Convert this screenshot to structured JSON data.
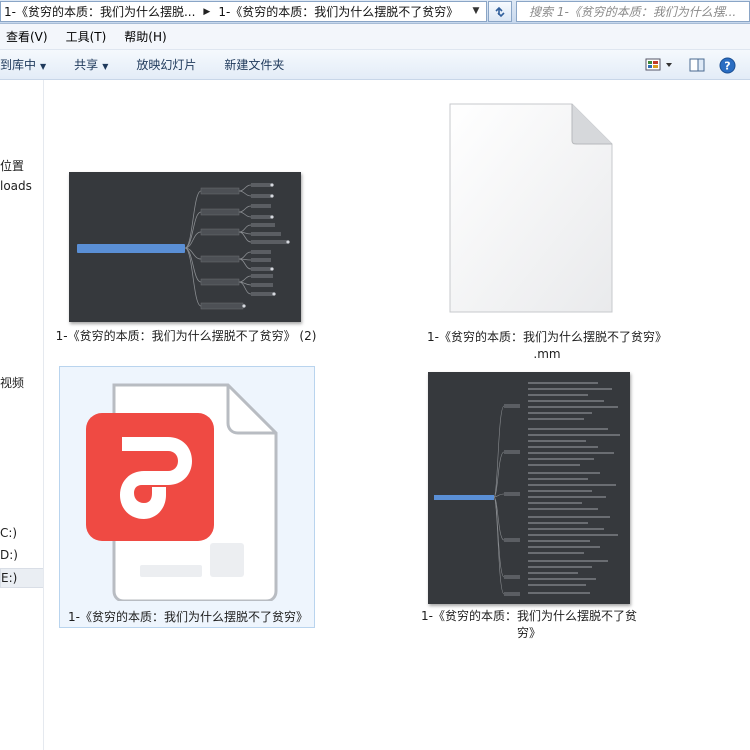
{
  "address_bar": {
    "crumbs": [
      "1-《贫穷的本质：我们为什么摆脱...",
      "1-《贫穷的本质：我们为什么摆脱不了贫穷》"
    ],
    "search_placeholder": "搜索 1-《贫穷的本质：我们为什么摆..."
  },
  "menu": [
    "查看(V)",
    "工具(T)",
    "帮助(H)"
  ],
  "toolbar": {
    "buttons": [
      {
        "label": "到库中",
        "dropdown": true
      },
      {
        "label": "共享",
        "dropdown": true
      },
      {
        "label": "放映幻灯片",
        "dropdown": false
      },
      {
        "label": "新建文件夹",
        "dropdown": false
      }
    ],
    "right_icons": [
      "views-icon",
      "preview-pane-icon",
      "help-icon"
    ]
  },
  "nav": {
    "items": [
      "位置",
      "loads",
      "视频",
      "C:)",
      "D:)",
      "E:)"
    ],
    "selected_index": 5
  },
  "files": [
    {
      "name": "1-《贫穷的本质：我们为什么摆脱不了贫穷》 (2)",
      "kind": "mindmap-image",
      "selected": false
    },
    {
      "name_line1": "1-《贫穷的本质：我们为什么摆脱不了贫穷》",
      "name_line2": ".mm",
      "kind": "generic-document",
      "selected": false
    },
    {
      "name": "1-《贫穷的本质：我们为什么摆脱不了贫穷》",
      "kind": "wps-pdf-document",
      "selected": true
    },
    {
      "name": "1-《贫穷的本质：我们为什么摆脱不了贫穷》",
      "kind": "mindmap-image-tall",
      "selected": false
    }
  ],
  "colors": {
    "thumbnail_bg": "#36393d",
    "mindmap_root": "#5a8fd6",
    "pdf_icon_red": "#ef4a43",
    "selection_bg": "#eef5fd"
  }
}
